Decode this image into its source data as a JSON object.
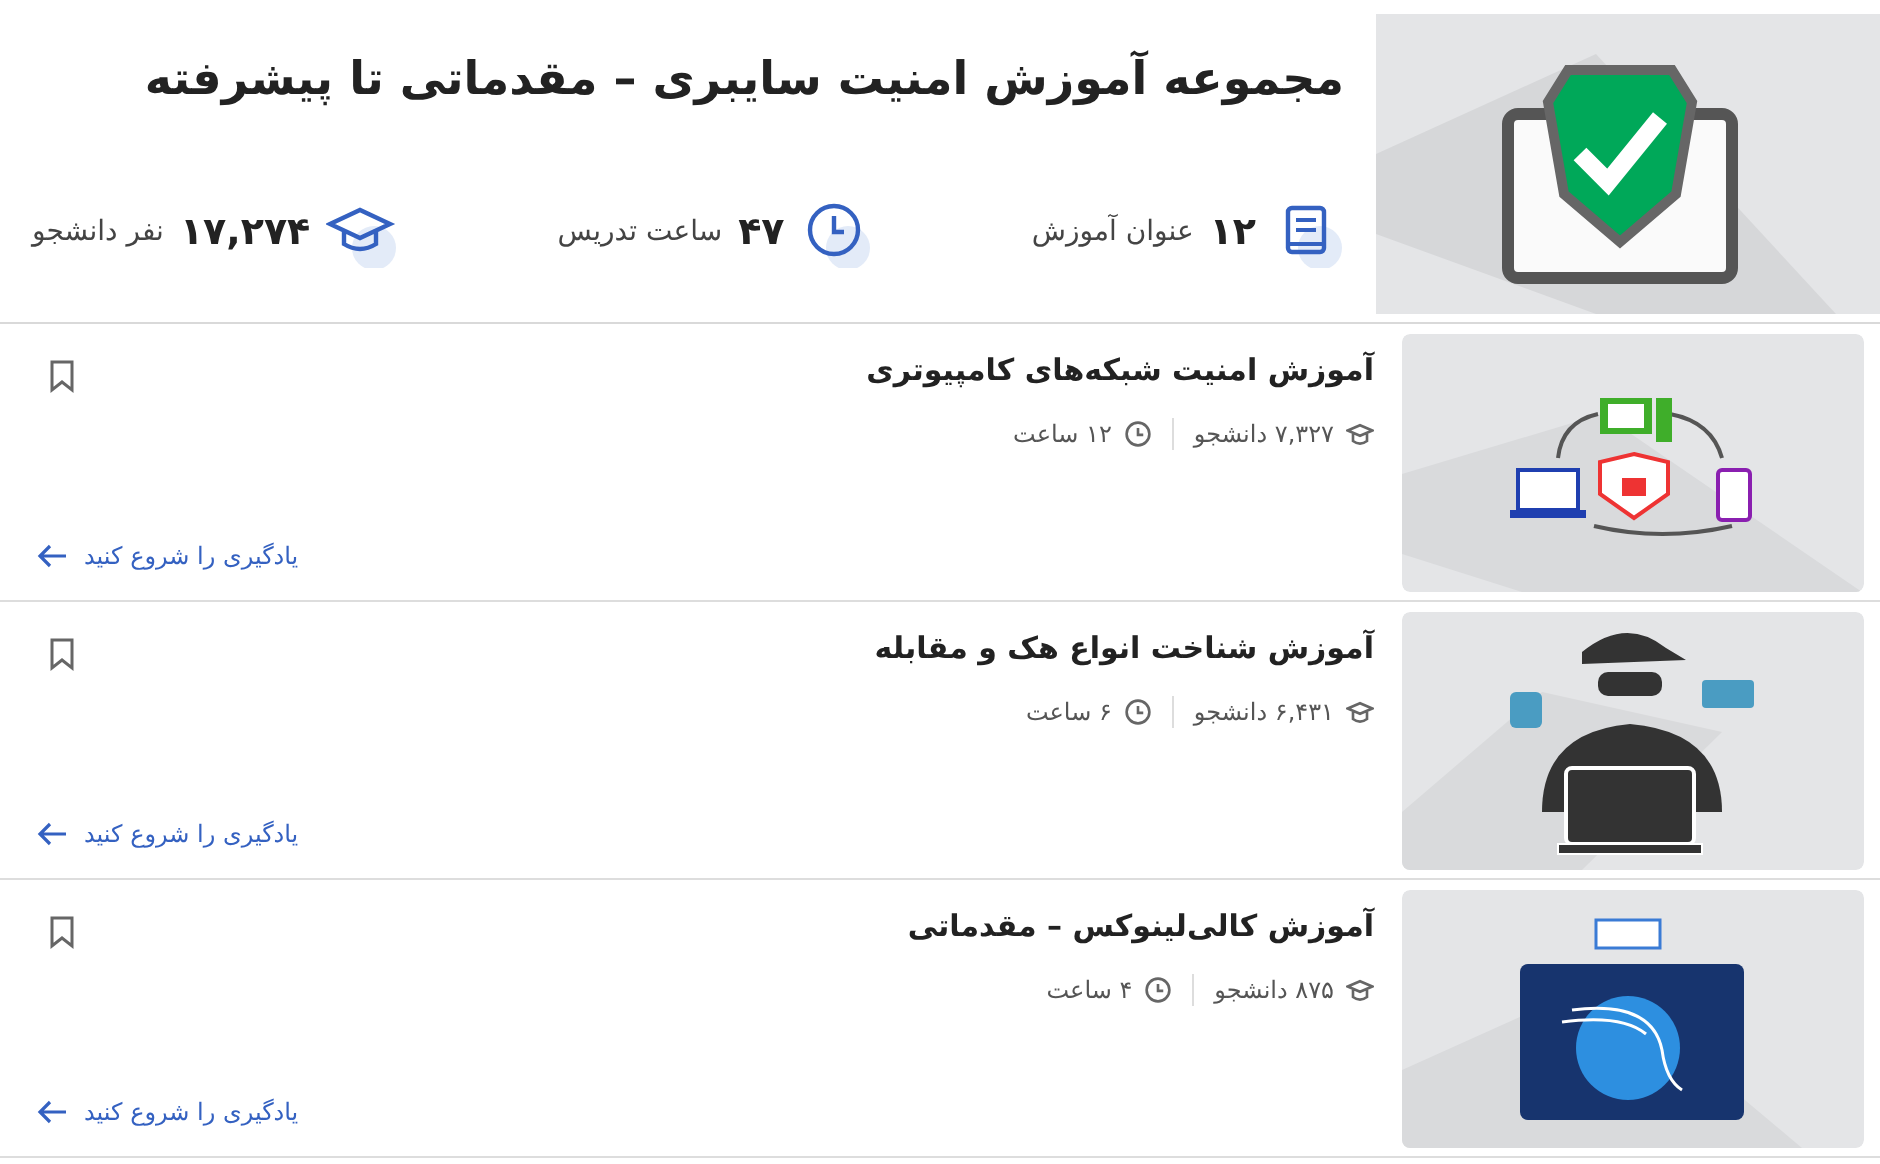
{
  "header": {
    "title": "مجموعه آموزش امنیت سایبری – مقدماتی تا پیشرفته",
    "kind": "shield",
    "stats": [
      {
        "kind": "courses",
        "value": "۱۲",
        "label": "عنوان آموزش"
      },
      {
        "kind": "hours",
        "value": "۴۷",
        "label": "ساعت تدریس"
      },
      {
        "kind": "students",
        "value": "۱۷,۲۷۴",
        "label": "نفر دانشجو"
      }
    ]
  },
  "courses": [
    {
      "title": "آموزش امنیت شبکه‌های کامپیوتری",
      "students": "۷,۳۲۷ دانشجو",
      "hours": "۱۲ ساعت",
      "cta": "یادگیری را شروع کنید",
      "kind": "network"
    },
    {
      "title": "آموزش شناخت انواع هک و مقابله",
      "students": "۶,۴۳۱ دانشجو",
      "hours": "۶ ساعت",
      "cta": "یادگیری را شروع کنید",
      "kind": "hacker"
    },
    {
      "title": "آموزش کالی‌لینوکس – مقدماتی",
      "students": "۸۷۵ دانشجو",
      "hours": "۴ ساعت",
      "cta": "یادگیری را شروع کنید",
      "kind": "kali"
    }
  ]
}
